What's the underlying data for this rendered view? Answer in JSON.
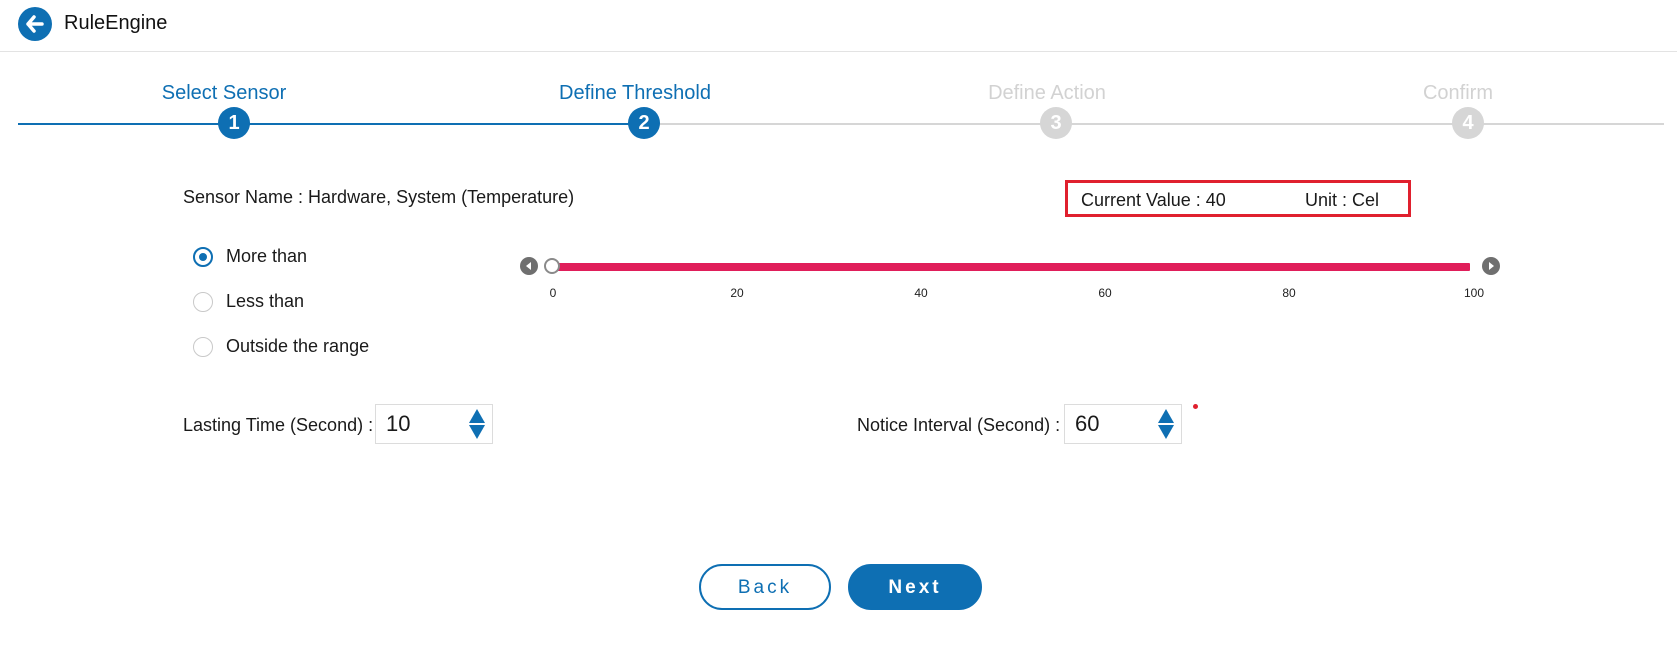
{
  "app": {
    "title": "RuleEngine",
    "back_icon": "arrow-left-icon",
    "accent": "#0e6fb3"
  },
  "stepper": {
    "steps": [
      {
        "label": "Select Sensor",
        "number": "1",
        "state": "done"
      },
      {
        "label": "Define Threshold",
        "number": "2",
        "state": "active"
      },
      {
        "label": "Define Action",
        "number": "3",
        "state": "todo"
      },
      {
        "label": "Confirm",
        "number": "4",
        "state": "todo"
      }
    ]
  },
  "sensor": {
    "name": "Sensor Name : Hardware, System (Temperature)",
    "current_value": "Current Value : 40",
    "unit": "Unit : Cel",
    "highlight_color": "#e0202e"
  },
  "condition": {
    "options": [
      {
        "label": "More than",
        "checked": true
      },
      {
        "label": "Less than",
        "checked": false
      },
      {
        "label": "Outside the range",
        "checked": false
      }
    ]
  },
  "slider": {
    "min": 0,
    "max": 100,
    "value": 0,
    "ticks": [
      "0",
      "20",
      "40",
      "60",
      "80",
      "100"
    ],
    "track_color": "#e01e5a"
  },
  "lasting_time": {
    "label": "Lasting Time (Second) :",
    "value": "10"
  },
  "notice_interval": {
    "label": "Notice Interval (Second) :",
    "value": "60"
  },
  "buttons": {
    "back": "Back",
    "next": "Next"
  }
}
